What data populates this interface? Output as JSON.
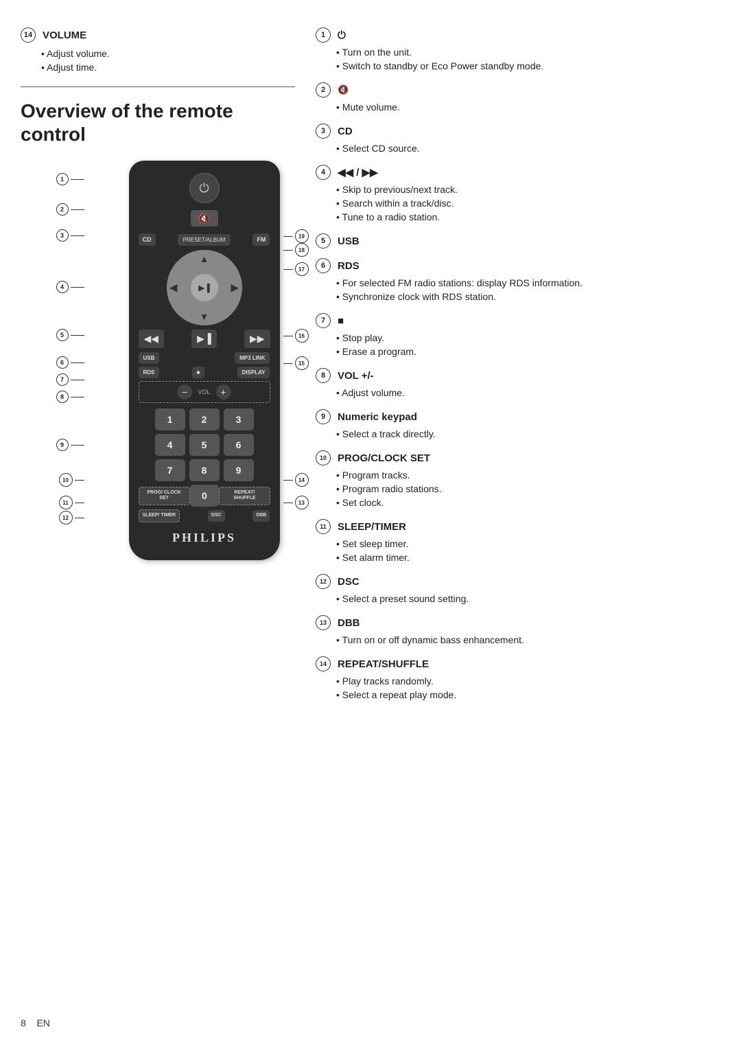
{
  "left": {
    "volume_badge": "14",
    "volume_title": "VOLUME",
    "volume_bullets": [
      "Adjust volume.",
      "Adjust time."
    ],
    "section_heading": "Overview of the remote control",
    "remote": {
      "philips_brand": "PHILIPS",
      "buttons": {
        "power": "⏻",
        "mute_icon": "🔇",
        "cd": "CD",
        "preset_album": "PRESET/ALBUM",
        "fm": "FM",
        "usb": "USB",
        "rds": "RDS",
        "stop": "■",
        "display": "DISPLAY",
        "mp3_link": "MP3 LINK",
        "vol_minus": "−",
        "vol_label": "VOL",
        "vol_plus": "+",
        "prog_clock": "PROG/ CLOCK SET",
        "zero": "0",
        "repeat_shuffle": "REPEAT/ SHUFFLE",
        "sleep_timer": "SLEEP/ TIMER",
        "dsc": "DSC",
        "dbb": "DBB"
      },
      "numpad": [
        "1",
        "2",
        "3",
        "4",
        "5",
        "6",
        "7",
        "8",
        "9"
      ],
      "callouts": [
        {
          "id": "1",
          "label": "1"
        },
        {
          "id": "2",
          "label": "2"
        },
        {
          "id": "3",
          "label": "3"
        },
        {
          "id": "4",
          "label": "4"
        },
        {
          "id": "5",
          "label": "5"
        },
        {
          "id": "6",
          "label": "6"
        },
        {
          "id": "7",
          "label": "7"
        },
        {
          "id": "8",
          "label": "8"
        },
        {
          "id": "9",
          "label": "9"
        },
        {
          "id": "10",
          "label": "10"
        },
        {
          "id": "11",
          "label": "11"
        },
        {
          "id": "12",
          "label": "12"
        },
        {
          "id": "13",
          "label": "13"
        },
        {
          "id": "14",
          "label": "14"
        },
        {
          "id": "15",
          "label": "15"
        },
        {
          "id": "16",
          "label": "16"
        },
        {
          "id": "17",
          "label": "17"
        },
        {
          "id": "18",
          "label": "18"
        },
        {
          "id": "19",
          "label": "19"
        }
      ]
    }
  },
  "right": {
    "items": [
      {
        "badge": "1",
        "symbol": "⏻",
        "title": "",
        "bullets": [
          "Turn on the unit.",
          "Switch to standby or Eco Power standby mode."
        ]
      },
      {
        "badge": "2",
        "symbol": "🔇",
        "title": "",
        "bullets": [
          "Mute volume."
        ]
      },
      {
        "badge": "3",
        "symbol": "",
        "title": "CD",
        "bullets": [
          "Select CD source."
        ]
      },
      {
        "badge": "4",
        "symbol": "◀◀ / ▶▶",
        "title": "",
        "bullets": [
          "Skip to previous/next track.",
          "Search within a track/disc.",
          "Tune to a radio station."
        ]
      },
      {
        "badge": "5",
        "symbol": "",
        "title": "USB",
        "bullets": []
      },
      {
        "badge": "6",
        "symbol": "",
        "title": "RDS",
        "bullets": [
          "For selected FM radio stations: display RDS information.",
          "Synchronize clock with RDS station."
        ]
      },
      {
        "badge": "7",
        "symbol": "■",
        "title": "",
        "bullets": [
          "Stop play.",
          "Erase a program."
        ]
      },
      {
        "badge": "8",
        "symbol": "",
        "title": "VOL +/-",
        "bullets": [
          "Adjust volume."
        ]
      },
      {
        "badge": "9",
        "symbol": "",
        "title": "Numeric keypad",
        "bullets": [
          "Select a track directly."
        ]
      },
      {
        "badge": "10",
        "symbol": "",
        "title": "PROG/CLOCK SET",
        "bullets": [
          "Program tracks.",
          "Program radio stations.",
          "Set clock."
        ]
      },
      {
        "badge": "11",
        "symbol": "",
        "title": "SLEEP/TIMER",
        "bullets": [
          "Set sleep timer.",
          "Set alarm timer."
        ]
      },
      {
        "badge": "12",
        "symbol": "",
        "title": "DSC",
        "bullets": [
          "Select a preset sound setting."
        ]
      },
      {
        "badge": "13",
        "symbol": "",
        "title": "DBB",
        "bullets": [
          "Turn on or off dynamic bass enhancement."
        ]
      },
      {
        "badge": "14",
        "symbol": "",
        "title": "REPEAT/SHUFFLE",
        "bullets": [
          "Play tracks randomly.",
          "Select a repeat play mode."
        ]
      }
    ]
  },
  "footer": {
    "page": "8",
    "lang": "EN"
  }
}
